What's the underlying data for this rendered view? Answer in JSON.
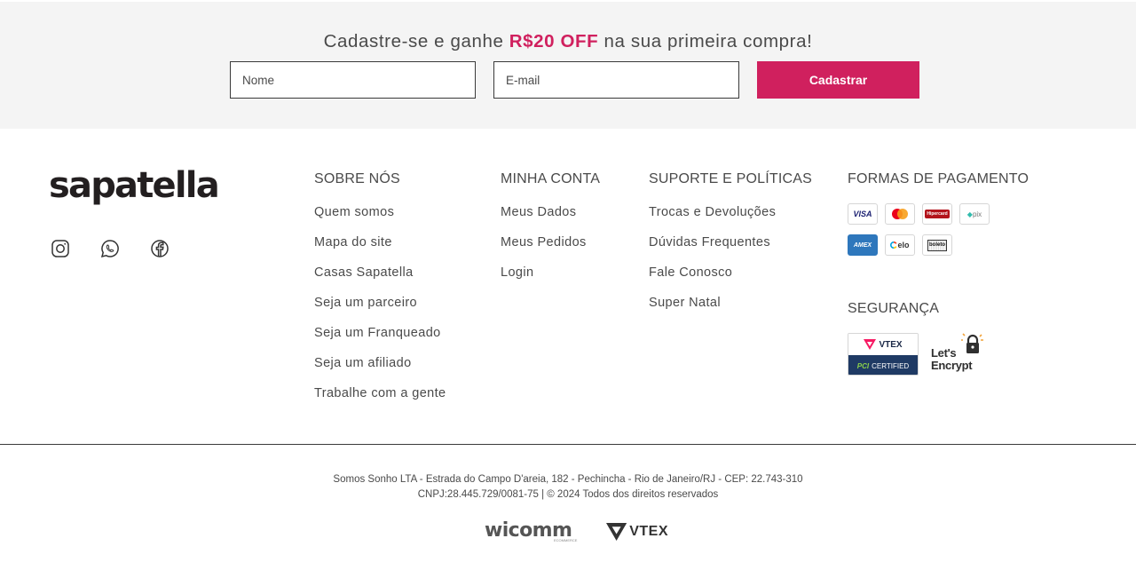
{
  "newsletter": {
    "title_prefix": "Cadastre-se e ganhe ",
    "title_promo": "R$20 OFF",
    "title_suffix": " na sua primeira compra!",
    "name_placeholder": "Nome",
    "email_placeholder": "E-mail",
    "submit_label": "Cadastrar"
  },
  "brand": {
    "logo_text": "sapatella",
    "social": [
      "instagram-icon",
      "whatsapp-icon",
      "facebook-icon"
    ]
  },
  "columns": [
    {
      "title": "SOBRE NÓS",
      "links": [
        "Quem somos",
        "Mapa do site",
        "Casas Sapatella",
        "Seja um parceiro",
        "Seja um Franqueado",
        "Seja um afiliado",
        "Trabalhe com a gente"
      ]
    },
    {
      "title": "MINHA CONTA",
      "links": [
        "Meus Dados",
        "Meus Pedidos",
        "Login"
      ]
    },
    {
      "title": "SUPORTE E POLÍTICAS",
      "links": [
        "Trocas e Devoluções",
        "Dúvidas Frequentes",
        "Fale Conosco",
        "Super Natal"
      ]
    }
  ],
  "payment": {
    "title": "FORMAS DE PAGAMENTO",
    "methods": [
      {
        "icon": "visa-icon",
        "label": "VISA"
      },
      {
        "icon": "mastercard-icon",
        "label": ""
      },
      {
        "icon": "hipercard-icon",
        "label": "Hipercard"
      },
      {
        "icon": "pix-icon",
        "label": "pix"
      },
      {
        "icon": "amex-icon",
        "label": "AMEX"
      },
      {
        "icon": "elo-icon",
        "label": "elo"
      },
      {
        "icon": "boleto-icon",
        "label": "boleto"
      }
    ]
  },
  "security": {
    "title": "SEGURANÇA",
    "vtex_label": "VTEX",
    "pci_prefix": "PCI",
    "pci_label": "CERTIFIED",
    "letsencrypt_line1": "Let's",
    "letsencrypt_line2": "Encrypt"
  },
  "footer": {
    "address": "Somos Sonho LTA - Estrada do Campo D'areia, 182 - Pechincha - Rio de Janeiro/RJ - CEP: 22.743-310",
    "cnpj": "CNPJ:28.445.729/0081-75 | © 2024 Todos dos direitos reservados",
    "partner_wicomm": "wicomm",
    "partner_wicomm_sub": "ECOMMERCE",
    "partner_vtex": "VTEX"
  },
  "colors": {
    "accent": "#d0205e",
    "band_bg": "#f4f4f4",
    "text": "#4a4a4a"
  }
}
